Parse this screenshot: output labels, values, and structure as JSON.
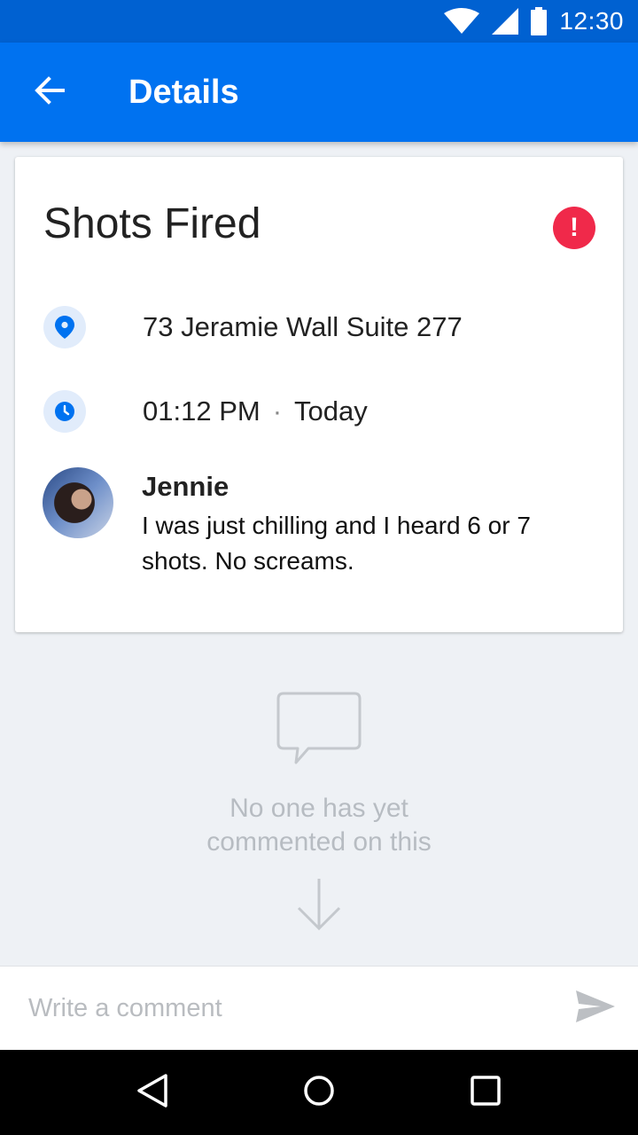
{
  "status_bar": {
    "time": "12:30",
    "icons": [
      "wifi-icon",
      "signal-icon",
      "battery-icon"
    ]
  },
  "app_bar": {
    "title": "Details",
    "back_icon": "arrow-back-icon"
  },
  "incident": {
    "title": "Shots Fired",
    "alert_symbol": "!",
    "address": "73 Jeramie Wall Suite 277",
    "time": "01:12 PM",
    "separator": "·",
    "day": "Today",
    "report": {
      "author": "Jennie",
      "text": "I was just chilling and I heard 6 or 7 shots. No screams."
    }
  },
  "empty_state": {
    "line1": "No one has yet",
    "line2": "commented on this"
  },
  "comment_bar": {
    "placeholder": "Write a comment"
  },
  "colors": {
    "primary": "#0072f0",
    "status_bar": "#0061d1",
    "alert": "#f0294a",
    "background": "#eef1f5"
  }
}
